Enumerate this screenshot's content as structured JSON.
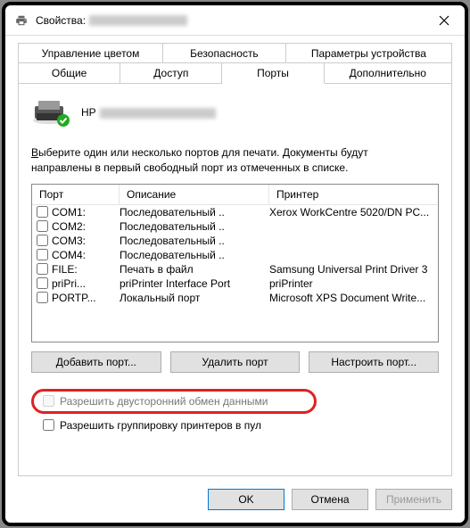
{
  "titlebar": {
    "prefix": "Свойства:"
  },
  "tabs": {
    "top": [
      "Управление цветом",
      "Безопасность",
      "Параметры устройства"
    ],
    "bottom": [
      "Общие",
      "Доступ",
      "Порты",
      "Дополнительно"
    ],
    "active": "Порты"
  },
  "printer": {
    "name_prefix": "HP"
  },
  "instruction": {
    "lead_char": "В",
    "line1_rest": "ыберите один или несколько портов для печати. Документы будут",
    "line2": "направлены в первый свободный порт из отмеченных в списке."
  },
  "ports_table": {
    "headers": {
      "port": "Порт",
      "desc": "Описание",
      "printer": "Принтер"
    },
    "rows": [
      {
        "port": "COM1:",
        "desc": "Последовательный ..",
        "printer": "Xerox WorkCentre 5020/DN PC..."
      },
      {
        "port": "COM2:",
        "desc": "Последовательный ..",
        "printer": ""
      },
      {
        "port": "COM3:",
        "desc": "Последовательный ..",
        "printer": ""
      },
      {
        "port": "COM4:",
        "desc": "Последовательный ..",
        "printer": ""
      },
      {
        "port": "FILE:",
        "desc": "Печать в файл",
        "printer": "Samsung Universal Print Driver 3"
      },
      {
        "port": "priPri...",
        "desc": "priPrinter Interface Port",
        "printer": "priPrinter"
      },
      {
        "port": "PORTP...",
        "desc": "Локальный порт",
        "printer": "Microsoft XPS Document Write..."
      }
    ]
  },
  "port_buttons": {
    "add": "Добавить порт...",
    "delete": "Удалить порт",
    "configure": "Настроить порт..."
  },
  "checkboxes": {
    "bidirectional": "Разрешить двусторонний обмен данными",
    "pooling": "Разрешить группировку принтеров в пул"
  },
  "dialog_buttons": {
    "ok": "OK",
    "cancel": "Отмена",
    "apply": "Применить"
  }
}
